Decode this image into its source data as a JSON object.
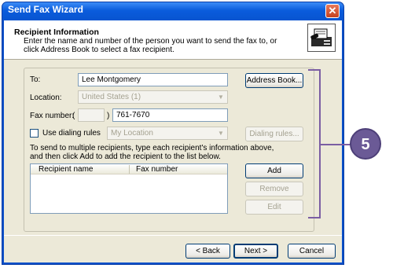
{
  "window": {
    "title": "Send Fax Wizard",
    "close_glyph": "✕"
  },
  "header": {
    "title": "Recipient Information",
    "description": "Enter the name and number of the person you want to send the fax to, or click Address Book to select a fax recipient."
  },
  "form": {
    "to_label": "To:",
    "to_value": "Lee Montgomery",
    "location_label": "Location:",
    "location_value": "United States (1)",
    "fax_label": "Fax number:",
    "fax_open_paren": "(",
    "fax_close_paren": ")",
    "fax_area_code": "",
    "fax_number": "761-7670",
    "dialing_rules_label": "Use dialing rules",
    "dialing_rules_checked": false,
    "dialing_location_value": "My Location",
    "instructions": "To send to multiple recipients, type each recipient's information above, and then click Add to add the recipient to the list below."
  },
  "buttons": {
    "address_book": "Address Book...",
    "dialing_rules": "Dialing rules...",
    "add": "Add",
    "remove": "Remove",
    "edit": "Edit",
    "back": "< Back",
    "next": "Next >",
    "cancel": "Cancel"
  },
  "recipient_list": {
    "columns": [
      "Recipient name",
      "Fax number"
    ],
    "rows": []
  },
  "callout": {
    "number": "5"
  },
  "colors": {
    "titlebar": "#0a5cdc",
    "dialog_bg": "#ece9d8",
    "callout": "#6b5a96"
  },
  "icons": {
    "header": "fax-machine-icon",
    "close": "close-icon"
  }
}
